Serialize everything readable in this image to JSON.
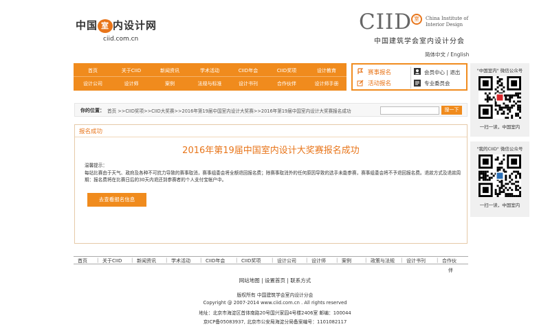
{
  "header": {
    "logo_text": "中国",
    "logo_badge": "室",
    "logo_text2": "内设计网",
    "logo_url": "ciid.com.cn",
    "ciid": "CIID",
    "ciid_badge": "室",
    "ciid_en1": "China Institute of",
    "ciid_en2": "Interior Design",
    "ciid_cn": "中国建筑学会室内设计分会",
    "lang": "简体中文 / English"
  },
  "nav": {
    "row1": [
      "首页",
      "关于CIID",
      "新闻资讯",
      "学术活动",
      "CIID年会",
      "CIID奖项",
      "设计教育"
    ],
    "row2": [
      "设计公司",
      "设计师",
      "案例",
      "法规与标准",
      "设计书刊",
      "合作伙伴",
      "设计师手册"
    ]
  },
  "quick": {
    "apply": "赛事报名",
    "activity": "活动报名",
    "member": "会员中心",
    "logout": "退出",
    "committee": "专业委员会",
    "sep": "|"
  },
  "side": {
    "wechat1_title": "\"中国室内\" 微信公众号",
    "wechat1_foot": "一扫一读，中国室内",
    "wechat2_title": "\"我的CIID\" 微信公众号",
    "wechat2_foot": "一扫一读，中国室内"
  },
  "breadcrumb": {
    "label": "你的位置：",
    "path": "首页 >>CIID奖项>>CIID大奖赛>>2016年第19届中国室内设计大奖赛>>2016年第19届中国室内设计大奖赛报名成功",
    "search_value": "",
    "search_button": "搜一下"
  },
  "panel": {
    "head": "报名成功",
    "title": "2016年第19届中国室内设计大奖赛报名成功",
    "tip_title": "温馨提示：",
    "tip_body": "每站比赛由于天气、政府及各种不可抗力导致的赛事取消，赛事组委会将全额退回报名费；除赛事取消外的任何原因导致的选手未能参赛，赛事组委会将不予退回报名费。退款方式及退款周期：报名费将在比赛日后的30天内退还到参赛者的个人支付宝帐户中。",
    "view_button": "去查看报名信息"
  },
  "footer": {
    "nav": [
      "首页",
      "关于CIID",
      "新闻资讯",
      "学术活动",
      "CIID年会",
      "CIID奖项",
      "设计公司",
      "设计师",
      "案例",
      "政策与法规",
      "设计书刊",
      "合作伙"
    ],
    "nav_extra": "伴",
    "sep": "|",
    "links": "网站地图 | 设置首页 | 联系方式",
    "owner": "版权所有  中国建筑学会室内设计分会",
    "copyright": "Copyright @ 2007-2014 www.ciid.com.cn . All rights reserved",
    "address": "地址：北京市海淀区首体南路20号国兴家园4号楼2406室  邮编：100044",
    "icp": "京ICP备05083937, 北京市公安局海淀分局备案编号：1101082117"
  }
}
